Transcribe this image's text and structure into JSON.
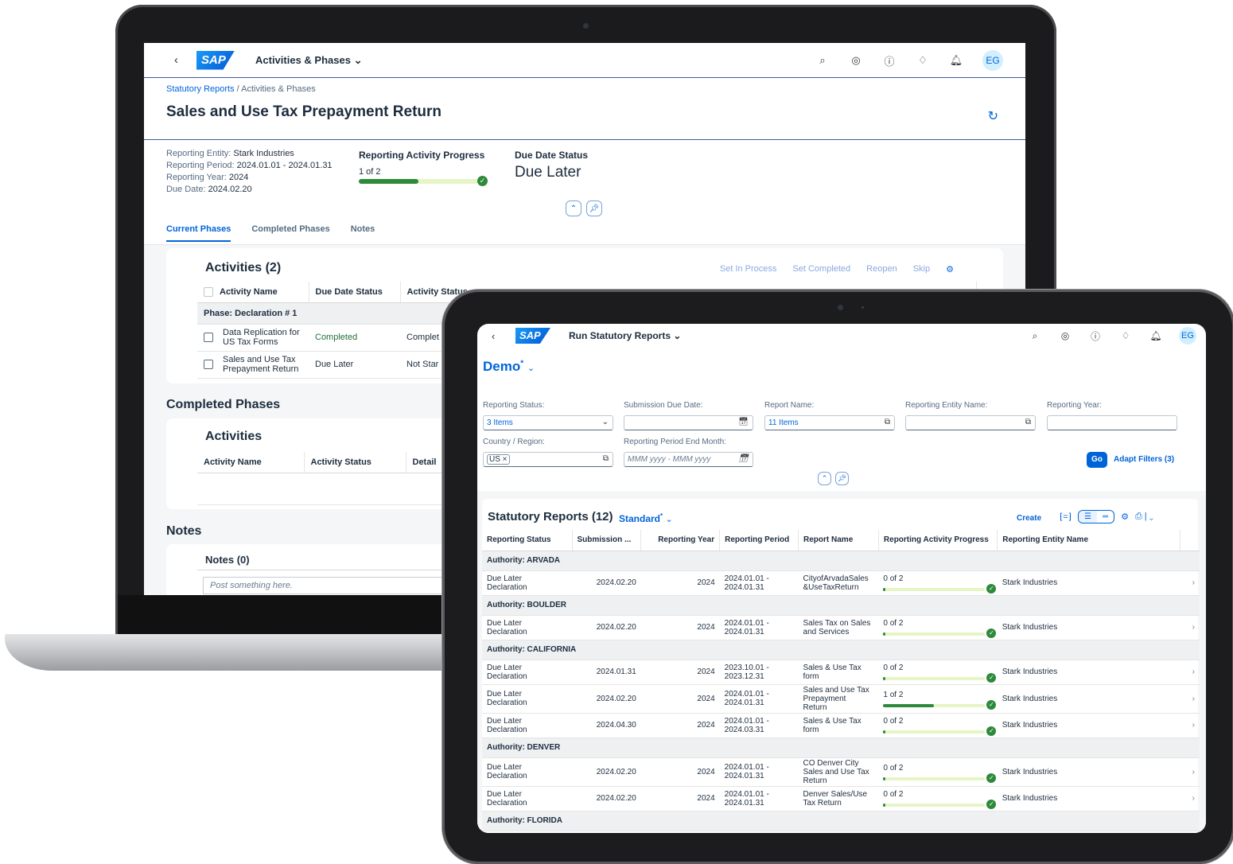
{
  "laptop": {
    "shell": {
      "back": "‹",
      "logo": "SAP",
      "app_title": "Activities & Phases",
      "app_chevron": "⌄",
      "icons": [
        "search-icon",
        "copilot-icon",
        "help-icon",
        "diamond-icon",
        "bell-icon"
      ],
      "avatar": "EG"
    },
    "breadcrumb": {
      "link": "Statutory Reports",
      "separator": " / ",
      "current": "Activities & Phases"
    },
    "title": "Sales and Use Tax Prepayment Return",
    "attributes": [
      {
        "label": "Reporting Entity:",
        "value": "Stark Industries"
      },
      {
        "label": "Reporting Period:",
        "value": "2024.01.01 - 2024.01.31"
      },
      {
        "label": "Reporting Year:",
        "value": "2024"
      },
      {
        "label": "Due Date:",
        "value": "2024.02.20"
      }
    ],
    "progress": {
      "title": "Reporting Activity Progress",
      "text": "1 of 2",
      "fraction": 0.5
    },
    "due_status": {
      "title": "Due Date Status",
      "value": "Due Later"
    },
    "tabs": [
      "Current Phases",
      "Completed Phases",
      "Notes"
    ],
    "activities": {
      "title": "Activities (2)",
      "actions": [
        "Set In Process",
        "Set Completed",
        "Reopen",
        "Skip"
      ],
      "columns": [
        "Activity Name",
        "Due Date Status",
        "Activity Status"
      ],
      "group": "Phase: Declaration # 1",
      "rows": [
        {
          "name_line1": "Data Replication for",
          "name_line2": "US Tax Forms",
          "due": "Completed",
          "status": "Complet"
        },
        {
          "name_line1": "Sales and Use Tax",
          "name_line2": "Prepayment Return",
          "due": "Due Later",
          "status": "Not Star"
        }
      ]
    },
    "completed": {
      "heading": "Completed Phases",
      "card_title": "Activities",
      "columns": [
        "Activity Name",
        "Activity Status",
        "Detail"
      ]
    },
    "notes": {
      "heading": "Notes",
      "card_title": "Notes (0)",
      "placeholder": "Post something here."
    }
  },
  "tablet": {
    "shell": {
      "back": "‹",
      "logo": "SAP",
      "app_title": "Run Statutory Reports",
      "app_chevron": "⌄",
      "icons": [
        "search-icon",
        "copilot-icon",
        "help-icon",
        "diamond-icon",
        "bell-icon"
      ],
      "avatar": "EG"
    },
    "variant": "Demo",
    "variant_mark": "*",
    "filters": {
      "reporting_status": {
        "label": "Reporting Status:",
        "value": "3 Items"
      },
      "submission_due_date": {
        "label": "Submission Due Date:",
        "value": ""
      },
      "report_name": {
        "label": "Report Name:",
        "value": "11 Items"
      },
      "reporting_entity_name": {
        "label": "Reporting Entity Name:",
        "value": ""
      },
      "reporting_year": {
        "label": "Reporting Year:",
        "value": ""
      },
      "country_region": {
        "label": "Country / Region:",
        "token": "US ×"
      },
      "period_end_month": {
        "label": "Reporting Period End Month:",
        "placeholder": "MMM yyyy - MMM yyyy"
      }
    },
    "go_label": "Go",
    "adapt_filters": "Adapt Filters (3)",
    "table": {
      "title": "Statutory Reports (12)",
      "variant": "Standard",
      "variant_mark": "*",
      "create": "Create",
      "columns": [
        "Reporting Status",
        "Submission ...",
        "Reporting Year",
        "Reporting Period",
        "Report Name",
        "Reporting Activity Progress",
        "Reporting Entity Name"
      ],
      "groups": [
        {
          "label": "Authority: ARVADA",
          "rows": [
            {
              "status1": "Due Later",
              "status2": "Declaration",
              "due": "2024.02.20",
              "year": "2024",
              "period1": "2024.01.01 -",
              "period2": "2024.01.31",
              "name1": "CityofArvadaSales",
              "name2": "&UseTaxReturn",
              "name3": "",
              "progress": "0 of 2",
              "fraction": 0,
              "entity": "Stark Industries"
            }
          ]
        },
        {
          "label": "Authority: BOULDER",
          "rows": [
            {
              "status1": "Due Later",
              "status2": "Declaration",
              "due": "2024.02.20",
              "year": "2024",
              "period1": "2024.01.01 -",
              "period2": "2024.01.31",
              "name1": "Sales Tax on Sales",
              "name2": "and Services",
              "name3": "",
              "progress": "0 of 2",
              "fraction": 0,
              "entity": "Stark Industries"
            }
          ]
        },
        {
          "label": "Authority: CALIFORNIA",
          "rows": [
            {
              "status1": "Due Later",
              "status2": "Declaration",
              "due": "2024.01.31",
              "year": "2024",
              "period1": "2023.10.01 -",
              "period2": "2023.12.31",
              "name1": "Sales & Use Tax",
              "name2": "form",
              "name3": "",
              "progress": "0 of 2",
              "fraction": 0,
              "entity": "Stark Industries"
            },
            {
              "status1": "Due Later",
              "status2": "Declaration",
              "due": "2024.02.20",
              "year": "2024",
              "period1": "2024.01.01 -",
              "period2": "2024.01.31",
              "name1": "Sales and Use Tax",
              "name2": "Prepayment",
              "name3": "Return",
              "progress": "1 of 2",
              "fraction": 0.5,
              "entity": "Stark Industries"
            },
            {
              "status1": "Due Later",
              "status2": "Declaration",
              "due": "2024.04.30",
              "year": "2024",
              "period1": "2024.01.01 -",
              "period2": "2024.03.31",
              "name1": "Sales & Use Tax",
              "name2": "form",
              "name3": "",
              "progress": "0 of 2",
              "fraction": 0,
              "entity": "Stark Industries"
            }
          ]
        },
        {
          "label": "Authority: DENVER",
          "rows": [
            {
              "status1": "Due Later",
              "status2": "Declaration",
              "due": "2024.02.20",
              "year": "2024",
              "period1": "2024.01.01 -",
              "period2": "2024.01.31",
              "name1": "CO Denver City",
              "name2": "Sales and Use Tax",
              "name3": "Return",
              "progress": "0 of 2",
              "fraction": 0,
              "entity": "Stark Industries"
            },
            {
              "status1": "Due Later",
              "status2": "Declaration",
              "due": "2024.02.20",
              "year": "2024",
              "period1": "2024.01.01 -",
              "period2": "2024.01.31",
              "name1": "Denver Sales/Use",
              "name2": "Tax Return",
              "name3": "",
              "progress": "0 of 2",
              "fraction": 0,
              "entity": "Stark Industries"
            }
          ]
        },
        {
          "label": "Authority: FLORIDA",
          "rows": []
        }
      ]
    }
  }
}
